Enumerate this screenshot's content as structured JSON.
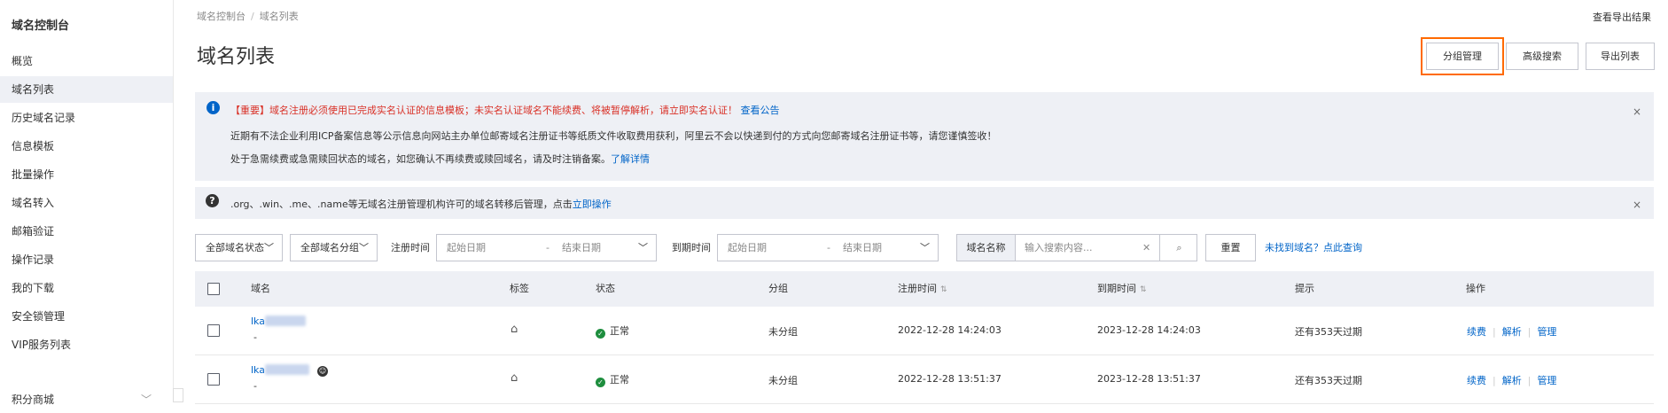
{
  "sidebar": {
    "title": "域名控制台",
    "items": [
      {
        "label": "概览"
      },
      {
        "label": "域名列表"
      },
      {
        "label": "历史域名记录"
      },
      {
        "label": "信息模板"
      },
      {
        "label": "批量操作"
      },
      {
        "label": "域名转入"
      },
      {
        "label": "邮箱验证"
      },
      {
        "label": "操作记录"
      },
      {
        "label": "我的下载"
      },
      {
        "label": "安全锁管理"
      },
      {
        "label": "VIP服务列表"
      },
      {
        "label": "积分商城"
      }
    ],
    "active_index": 1
  },
  "breadcrumb": [
    "域名控制台",
    "域名列表"
  ],
  "header": {
    "title": "域名列表",
    "export_result": "查看导出结果",
    "buttons": {
      "group_manage": "分组管理",
      "advanced_search": "高级搜索",
      "export_list": "导出列表"
    }
  },
  "notice_info": {
    "icon": "info-icon",
    "line1_red": "【重要】域名注册必须使用已完成实名认证的信息模板；未实名认证域名不能续费、将被暂停解析，请立即实名认证！",
    "line1_link": "查看公告",
    "line2": "近期有不法企业利用ICP备案信息等公示信息向网站主办单位邮寄域名注册证书等纸质文件收取费用获利，阿里云不会以快递到付的方式向您邮寄域名注册证书等，请您谨慎签收！",
    "line3": "处于急需续费或急需赎回状态的域名，如您确认不再续费或赎回域名，请及时注销备案。",
    "line3_link": "了解详情",
    "close": "×"
  },
  "notice_help": {
    "icon": "question-icon",
    "text": ".org、.win、.me、.name等无域名注册管理机构许可的域名转移后管理，点击",
    "link": "立即操作",
    "close": "×"
  },
  "filters": {
    "status_select": "全部域名状态",
    "group_select": "全部域名分组",
    "reg_time_label": "注册时间",
    "reg_start_placeholder": "起始日期",
    "reg_end_placeholder": "结束日期",
    "exp_time_label": "到期时间",
    "exp_start_placeholder": "起始日期",
    "exp_end_placeholder": "结束日期",
    "search_type": "域名名称",
    "search_placeholder": "输入搜索内容...",
    "reset_button": "重置",
    "not_found_link": "未找到域名？点此查询"
  },
  "table": {
    "headers": {
      "domain": "域名",
      "tag": "标签",
      "status": "状态",
      "group": "分组",
      "reg_time": "注册时间",
      "exp_time": "到期时间",
      "hint": "提示",
      "ops": "操作"
    },
    "rows": [
      {
        "domain_prefix": "lka",
        "sub": "-",
        "status": "正常",
        "group": "未分组",
        "reg_time": "2022-12-28 14:24:03",
        "exp_time": "2023-12-28 14:24:03",
        "hint": "还有353天过期",
        "ops": [
          "续费",
          "解析",
          "管理"
        ]
      },
      {
        "domain_prefix": "lka",
        "sub": "-",
        "status": "正常",
        "group": "未分组",
        "reg_time": "2022-12-28 13:51:37",
        "exp_time": "2023-12-28 13:51:37",
        "hint": "还有353天过期",
        "ops": [
          "续费",
          "解析",
          "管理"
        ]
      }
    ]
  },
  "colors": {
    "link": "#0064c8",
    "highlight": "#ff6a00",
    "notice_bg": "#eef0f5",
    "warning_red": "#d93026",
    "success": "#1e8e3e"
  }
}
